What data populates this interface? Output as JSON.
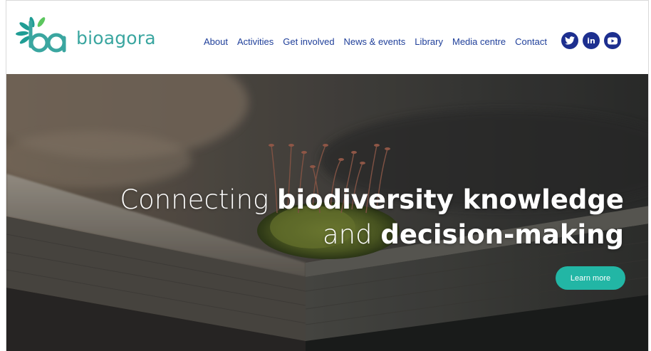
{
  "brand": {
    "name": "bioagora",
    "logo_color": "#3aa6a0"
  },
  "nav": {
    "items": [
      "About",
      "Activities",
      "Get involved",
      "News & events",
      "Library",
      "Media centre",
      "Contact"
    ],
    "color": "#1f3f9a"
  },
  "social": {
    "icons": [
      "twitter-icon",
      "linkedin-icon",
      "youtube-icon"
    ],
    "linkedin_text": "in",
    "color": "#1d2f8f"
  },
  "hero": {
    "line1_light": "Connecting ",
    "line1_bold": "biodiversity knowledge",
    "line2_light": "and ",
    "line2_bold": "decision-making",
    "button_label": "Learn more",
    "button_color": "#22b6a5"
  }
}
